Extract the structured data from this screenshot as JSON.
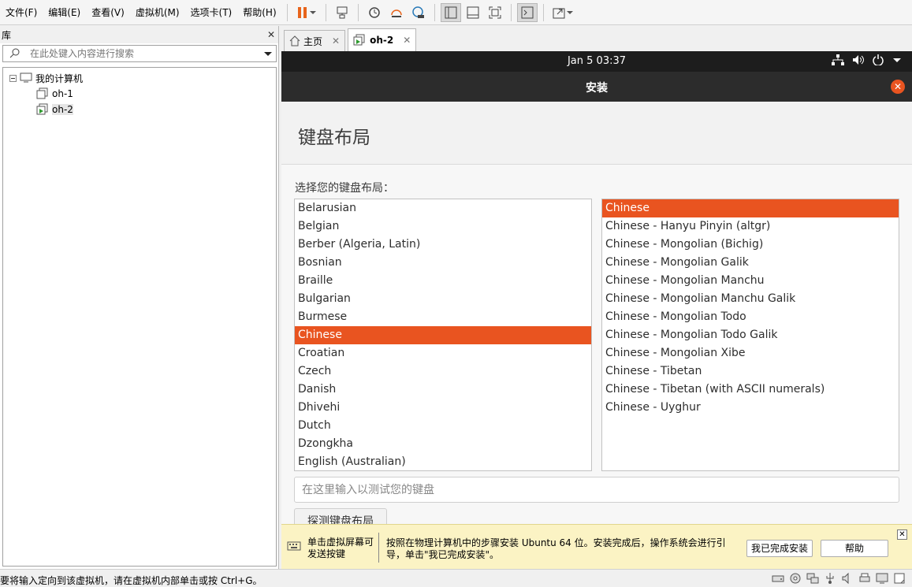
{
  "menu": [
    "文件(F)",
    "编辑(E)",
    "查看(V)",
    "虚拟机(M)",
    "选项卡(T)",
    "帮助(H)"
  ],
  "library": {
    "title": "库",
    "search_placeholder": "在此处键入内容进行搜索",
    "root": "我的计算机",
    "vms": [
      "oh-1",
      "oh-2"
    ]
  },
  "tabs": [
    {
      "label": "主页"
    },
    {
      "label": "oh-2"
    }
  ],
  "vm": {
    "clock": "Jan 5  03:37",
    "window_title": "安装",
    "page_title": "键盘布局",
    "prompt": "选择您的键盘布局：",
    "layouts": [
      "Belarusian",
      "Belgian",
      "Berber (Algeria, Latin)",
      "Bosnian",
      "Braille",
      "Bulgarian",
      "Burmese",
      "Chinese",
      "Croatian",
      "Czech",
      "Danish",
      "Dhivehi",
      "Dutch",
      "Dzongkha",
      "English (Australian)"
    ],
    "selected_layout": "Chinese",
    "variants": [
      "Chinese",
      "Chinese - Hanyu Pinyin (altgr)",
      "Chinese - Mongolian (Bichig)",
      "Chinese - Mongolian Galik",
      "Chinese - Mongolian Manchu",
      "Chinese - Mongolian Manchu Galik",
      "Chinese - Mongolian Todo",
      "Chinese - Mongolian Todo Galik",
      "Chinese - Mongolian Xibe",
      "Chinese - Tibetan",
      "Chinese - Tibetan (with ASCII numerals)",
      "Chinese - Uyghur"
    ],
    "selected_variant": "Chinese",
    "test_placeholder": "在这里输入以测试您的键盘",
    "detect_button": "探测键盘布局",
    "accent_color": "#e95420"
  },
  "hint": {
    "left_text": "单击虚拟屏幕可发送按键",
    "text": "按照在物理计算机中的步骤安装 Ubuntu 64 位。安装完成后，操作系统会进行引导，单击\"我已完成安装\"。",
    "done_button": "我已完成安装",
    "help_button": "帮助"
  },
  "status": {
    "text": "要将输入定向到该虚拟机，请在虚拟机内部单击或按 Ctrl+G。"
  }
}
